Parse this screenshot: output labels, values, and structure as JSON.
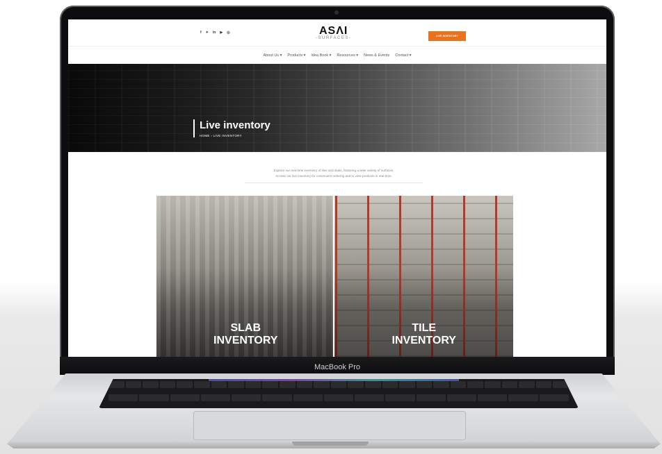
{
  "device": {
    "label": "MacBook Pro"
  },
  "header": {
    "socials": [
      "f",
      "✦",
      "in",
      "▶",
      "◎"
    ],
    "logo_main": "ASΛI",
    "logo_sub": "-SURFACES-",
    "live_button": "LIVE INVENTORY"
  },
  "nav": {
    "items": [
      "About Us ▾",
      "Products ▾",
      "Idea Book ▾",
      "Resources ▾",
      "News & Events",
      "Contact ▾"
    ]
  },
  "hero": {
    "title": "Live inventory",
    "breadcrumb": "HOME  ›  LIVE INVENTORY"
  },
  "intro": {
    "line1": "Explore our real-time inventory of tiles and slabs, featuring a wide variety of surfaces.",
    "line2": "Access our live inventory for convenient ordering and to view products in real-time."
  },
  "cards": [
    {
      "line1": "SLAB",
      "line2": "INVENTORY"
    },
    {
      "line1": "TILE",
      "line2": "INVENTORY"
    }
  ],
  "colors": {
    "accent": "#e8731c"
  }
}
